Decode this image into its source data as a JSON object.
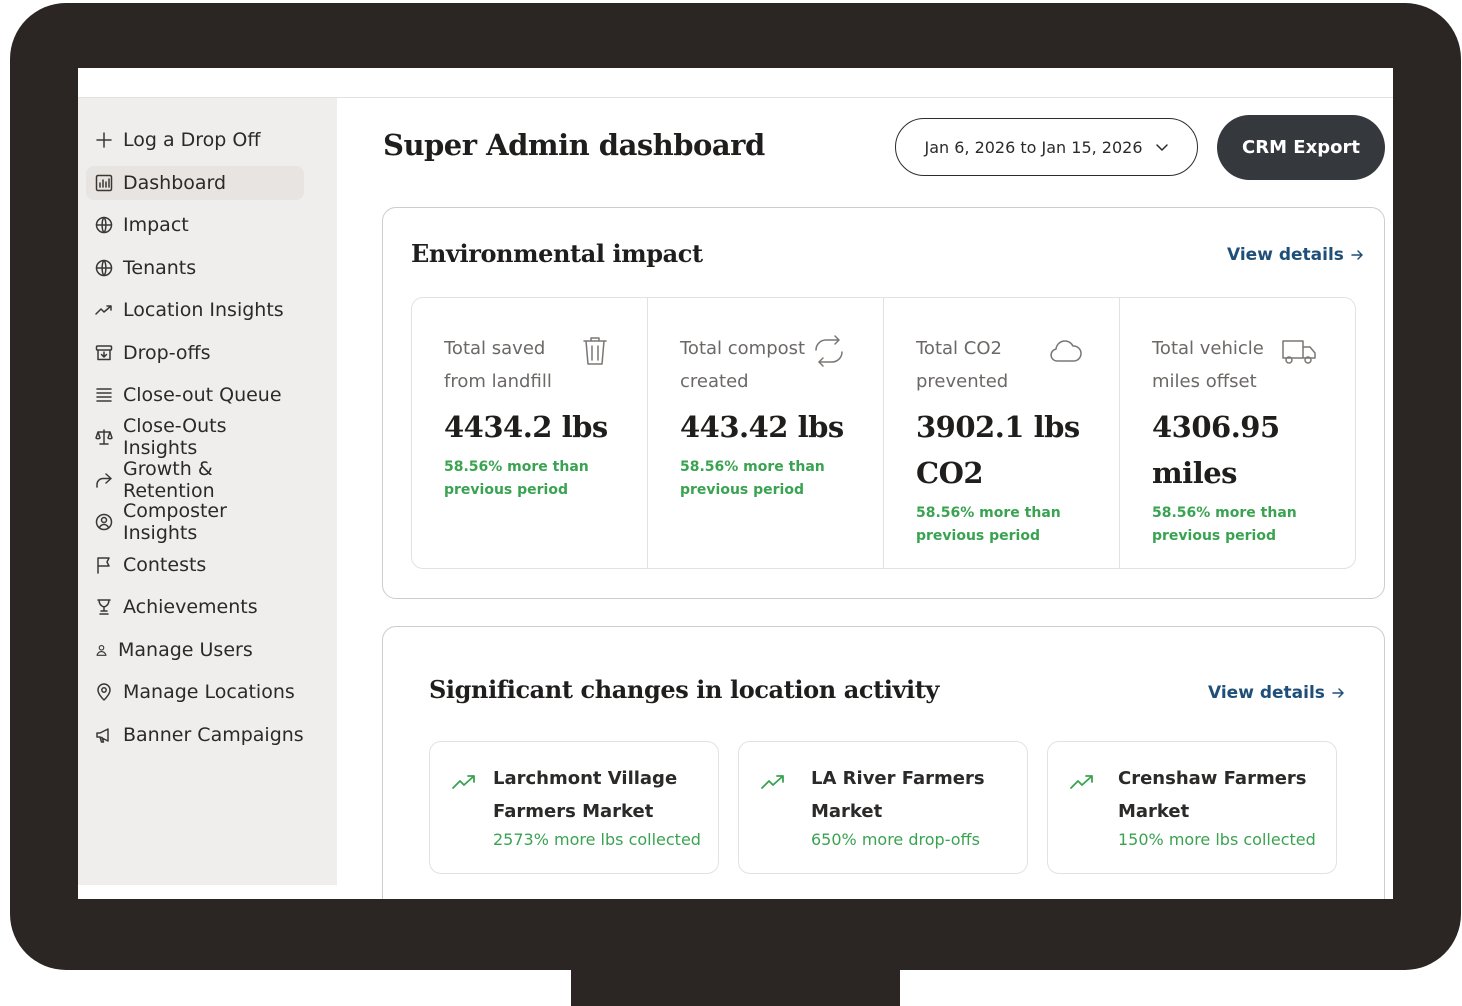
{
  "sidebar": {
    "items": [
      {
        "label": "Log a Drop Off",
        "icon": "plus-icon"
      },
      {
        "label": "Dashboard",
        "icon": "bar-chart-icon",
        "active": true
      },
      {
        "label": "Impact",
        "icon": "globe-icon"
      },
      {
        "label": "Tenants",
        "icon": "globe-icon"
      },
      {
        "label": "Location Insights",
        "icon": "trending-up-icon"
      },
      {
        "label": "Drop-offs",
        "icon": "archive-icon"
      },
      {
        "label": "Close-out Queue",
        "icon": "list-icon"
      },
      {
        "label": "Close-Outs Insights",
        "icon": "scale-icon"
      },
      {
        "label": "Growth & Retention",
        "icon": "share-icon"
      },
      {
        "label": "Composter Insights",
        "icon": "user-circle-icon"
      },
      {
        "label": "Contests",
        "icon": "flag-icon"
      },
      {
        "label": "Achievements",
        "icon": "trophy-icon"
      },
      {
        "label": "Manage Users",
        "icon": "user-icon"
      },
      {
        "label": "Manage Locations",
        "icon": "map-pin-icon"
      },
      {
        "label": "Banner Campaigns",
        "icon": "megaphone-icon"
      }
    ]
  },
  "header": {
    "title": "Super Admin dashboard",
    "date_range": "Jan 6, 2026 to Jan 15, 2026",
    "export_label": "CRM Export"
  },
  "environmental": {
    "title": "Environmental impact",
    "view_details": "View details",
    "stats": [
      {
        "label": "Total saved from landfill",
        "value": "4434.2 lbs",
        "change": "58.56% more than previous period",
        "icon": "trash-icon"
      },
      {
        "label": "Total compost created",
        "value": "443.42 lbs",
        "change": "58.56% more than previous period",
        "icon": "refresh-icon"
      },
      {
        "label": "Total CO2 prevented",
        "value": "3902.1 lbs CO2",
        "change": "58.56% more than previous period",
        "icon": "cloud-icon"
      },
      {
        "label": "Total vehicle miles offset",
        "value": "4306.95 miles",
        "change": "58.56% more than previous period",
        "icon": "truck-icon"
      }
    ]
  },
  "location_activity": {
    "title": "Significant changes in location activity",
    "view_details": "View details",
    "items": [
      {
        "name": "Larchmont Village Farmers Market",
        "change": "2573% more lbs collected",
        "icon": "trending-up-icon"
      },
      {
        "name": "LA River Farmers Market",
        "change": "650% more drop-offs",
        "icon": "trending-up-icon"
      },
      {
        "name": "Crenshaw Farmers Market",
        "change": "150% more lbs collected",
        "icon": "trending-up-icon"
      }
    ]
  },
  "colors": {
    "accent_green": "#3aa352",
    "link_blue": "#1f4f78",
    "button_dark": "#35393d",
    "sidebar_bg": "#f0eeec"
  }
}
